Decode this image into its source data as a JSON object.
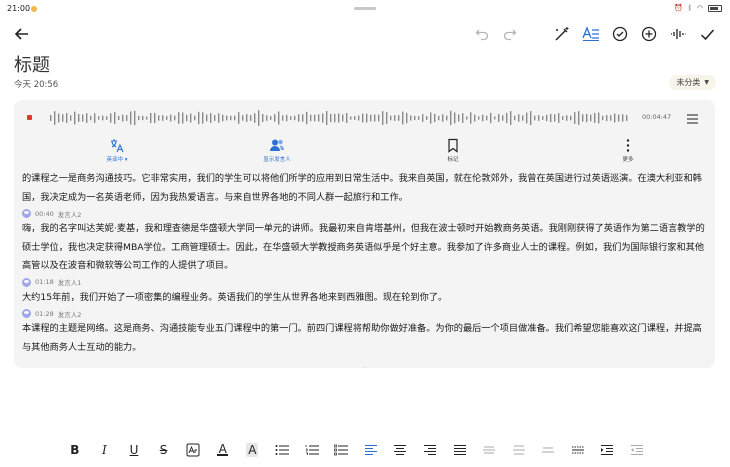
{
  "status_bar": {
    "time": "21:00"
  },
  "note": {
    "title": "标题",
    "date": "今天 20:56",
    "category": "未分类"
  },
  "player": {
    "duration": "00:04:47"
  },
  "tools": [
    {
      "label": "英译中",
      "icon": "translate-icon"
    },
    {
      "label": "显示发言人",
      "icon": "speakers-icon"
    },
    {
      "label": "标记",
      "icon": "bookmark-icon"
    },
    {
      "label": "更多",
      "icon": "more-icon"
    }
  ],
  "transcript": {
    "intro_text": "的课程之一是商务沟通技巧。它非常实用，我们的学生可以将他们所学的应用到日常生活中。我来自英国，就在伦敦郊外，我曾在英国进行过英语巡演。在澳大利亚和韩国，我决定成为一名英语老师，因为我热爱语言。与来自世界各地的不同人群一起旅行和工作。",
    "segments": [
      {
        "time": "00:40",
        "speaker": "发言人2",
        "text": "嗨，我的名字叫达芙妮·麦基，我和理查德是华盛顿大学同一单元的讲师。我最初来自肯塔基州，但我在波士顿时开始教商务英语。我刚刚获得了英语作为第二语言教学的硕士学位，我也决定获得MBA学位。工商管理硕士。因此，在华盛顿大学教授商务英语似乎是个好主意。我参加了许多商业人士的课程。例如，我们为国际银行家和其他高管以及在波音和微软等公司工作的人提供了项目。"
      },
      {
        "time": "01:18",
        "speaker": "发言人1",
        "text": "大约15年前，我们开始了一项密集的编程业务。英语我们的学生从世界各地来到西雅图。现在轮到你了。"
      },
      {
        "time": "01:28",
        "speaker": "发言人2",
        "text": "本课程的主题是网络。这是商务、沟通技能专业五门课程中的第一门。前四门课程将帮助你做好准备。为你的最后一个项目做准备。我们希望您能喜欢这门课程，并提高与其他商务人士互动的能力。"
      }
    ]
  },
  "format_bar": {
    "bold": "B",
    "italic": "I",
    "underline": "U",
    "strikethrough": "S",
    "text_color": "A",
    "highlight": "A"
  },
  "colors": {
    "accent": "#2b6fd6",
    "record": "#e0392b",
    "card_bg": "#f4f4f4",
    "avatar": "#9fa6e8"
  }
}
